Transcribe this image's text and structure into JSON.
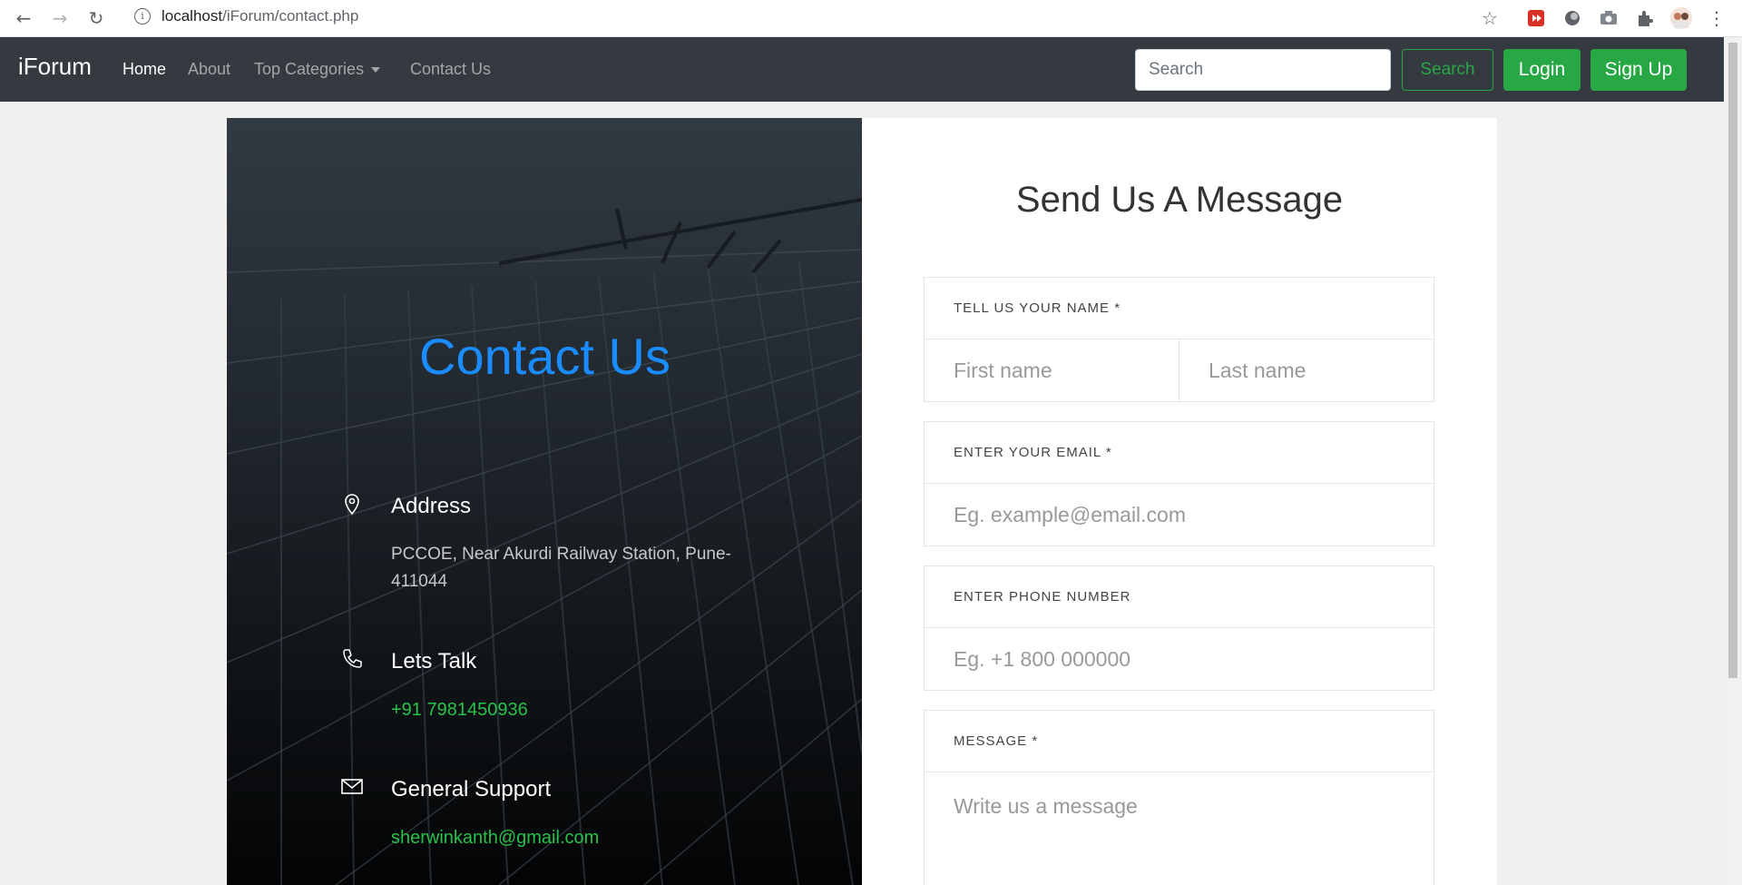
{
  "browser": {
    "url_host": "localhost",
    "url_path": "/iForum/contact.php"
  },
  "navbar": {
    "brand": "iForum",
    "links": [
      {
        "label": "Home",
        "active": true
      },
      {
        "label": "About"
      },
      {
        "label": "Top Categories",
        "dropdown": true
      },
      {
        "label": "Contact Us"
      }
    ],
    "search_placeholder": "Search",
    "search_button": "Search",
    "login_button": "Login",
    "signup_button": "Sign Up"
  },
  "contact": {
    "title": "Contact Us",
    "address_head": "Address",
    "address_text": "PCCOE, Near Akurdi Railway Station, Pune-411044",
    "talk_head": "Lets Talk",
    "talk_text": "+91 7981450936",
    "support_head": "General Support",
    "support_text": "sherwinkanth@gmail.com"
  },
  "form": {
    "title": "Send Us A Message",
    "name_label": "TELL US YOUR NAME *",
    "first_placeholder": "First name",
    "last_placeholder": "Last name",
    "email_label": "ENTER YOUR EMAIL *",
    "email_placeholder": "Eg. example@email.com",
    "phone_label": "ENTER PHONE NUMBER",
    "phone_placeholder": "Eg. +1 800 000000",
    "message_label": "MESSAGE *",
    "message_placeholder": "Write us a message"
  },
  "colors": {
    "navbar": "#343a40",
    "accent_green": "#28a745",
    "title_blue": "#1a8cff"
  }
}
